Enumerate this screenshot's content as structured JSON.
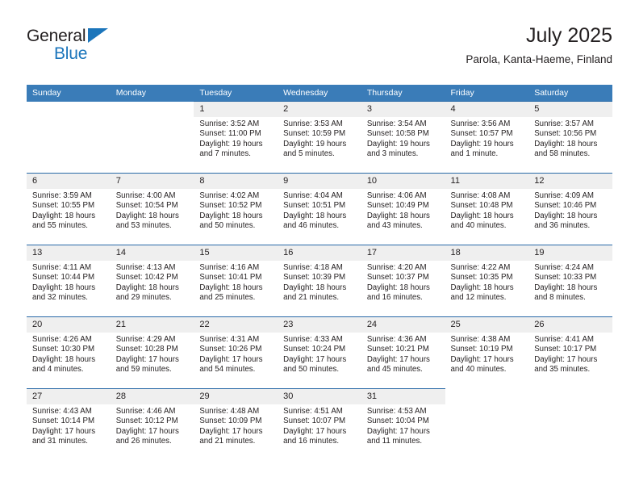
{
  "brand": {
    "line1": "General",
    "line2": "Blue",
    "accent_color": "#1b75bb",
    "triangle_icon": "logo-triangle-icon"
  },
  "header": {
    "title": "July 2025",
    "subtitle": "Parola, Kanta-Haeme, Finland"
  },
  "colors": {
    "header_blue": "#3a7cb8",
    "row_divider_blue": "#2a6aa8",
    "daynum_band": "#efefef",
    "text": "#231f20"
  },
  "weekdays": [
    "Sunday",
    "Monday",
    "Tuesday",
    "Wednesday",
    "Thursday",
    "Friday",
    "Saturday"
  ],
  "weeks": [
    [
      {
        "day": "",
        "sunrise": "",
        "sunset": "",
        "daylight_line1": "",
        "daylight_line2": "",
        "blank": true
      },
      {
        "day": "",
        "sunrise": "",
        "sunset": "",
        "daylight_line1": "",
        "daylight_line2": "",
        "blank": true
      },
      {
        "day": "1",
        "sunrise": "Sunrise: 3:52 AM",
        "sunset": "Sunset: 11:00 PM",
        "daylight_line1": "Daylight: 19 hours",
        "daylight_line2": "and 7 minutes."
      },
      {
        "day": "2",
        "sunrise": "Sunrise: 3:53 AM",
        "sunset": "Sunset: 10:59 PM",
        "daylight_line1": "Daylight: 19 hours",
        "daylight_line2": "and 5 minutes."
      },
      {
        "day": "3",
        "sunrise": "Sunrise: 3:54 AM",
        "sunset": "Sunset: 10:58 PM",
        "daylight_line1": "Daylight: 19 hours",
        "daylight_line2": "and 3 minutes."
      },
      {
        "day": "4",
        "sunrise": "Sunrise: 3:56 AM",
        "sunset": "Sunset: 10:57 PM",
        "daylight_line1": "Daylight: 19 hours",
        "daylight_line2": "and 1 minute."
      },
      {
        "day": "5",
        "sunrise": "Sunrise: 3:57 AM",
        "sunset": "Sunset: 10:56 PM",
        "daylight_line1": "Daylight: 18 hours",
        "daylight_line2": "and 58 minutes."
      }
    ],
    [
      {
        "day": "6",
        "sunrise": "Sunrise: 3:59 AM",
        "sunset": "Sunset: 10:55 PM",
        "daylight_line1": "Daylight: 18 hours",
        "daylight_line2": "and 55 minutes."
      },
      {
        "day": "7",
        "sunrise": "Sunrise: 4:00 AM",
        "sunset": "Sunset: 10:54 PM",
        "daylight_line1": "Daylight: 18 hours",
        "daylight_line2": "and 53 minutes."
      },
      {
        "day": "8",
        "sunrise": "Sunrise: 4:02 AM",
        "sunset": "Sunset: 10:52 PM",
        "daylight_line1": "Daylight: 18 hours",
        "daylight_line2": "and 50 minutes."
      },
      {
        "day": "9",
        "sunrise": "Sunrise: 4:04 AM",
        "sunset": "Sunset: 10:51 PM",
        "daylight_line1": "Daylight: 18 hours",
        "daylight_line2": "and 46 minutes."
      },
      {
        "day": "10",
        "sunrise": "Sunrise: 4:06 AM",
        "sunset": "Sunset: 10:49 PM",
        "daylight_line1": "Daylight: 18 hours",
        "daylight_line2": "and 43 minutes."
      },
      {
        "day": "11",
        "sunrise": "Sunrise: 4:08 AM",
        "sunset": "Sunset: 10:48 PM",
        "daylight_line1": "Daylight: 18 hours",
        "daylight_line2": "and 40 minutes."
      },
      {
        "day": "12",
        "sunrise": "Sunrise: 4:09 AM",
        "sunset": "Sunset: 10:46 PM",
        "daylight_line1": "Daylight: 18 hours",
        "daylight_line2": "and 36 minutes."
      }
    ],
    [
      {
        "day": "13",
        "sunrise": "Sunrise: 4:11 AM",
        "sunset": "Sunset: 10:44 PM",
        "daylight_line1": "Daylight: 18 hours",
        "daylight_line2": "and 32 minutes."
      },
      {
        "day": "14",
        "sunrise": "Sunrise: 4:13 AM",
        "sunset": "Sunset: 10:42 PM",
        "daylight_line1": "Daylight: 18 hours",
        "daylight_line2": "and 29 minutes."
      },
      {
        "day": "15",
        "sunrise": "Sunrise: 4:16 AM",
        "sunset": "Sunset: 10:41 PM",
        "daylight_line1": "Daylight: 18 hours",
        "daylight_line2": "and 25 minutes."
      },
      {
        "day": "16",
        "sunrise": "Sunrise: 4:18 AM",
        "sunset": "Sunset: 10:39 PM",
        "daylight_line1": "Daylight: 18 hours",
        "daylight_line2": "and 21 minutes."
      },
      {
        "day": "17",
        "sunrise": "Sunrise: 4:20 AM",
        "sunset": "Sunset: 10:37 PM",
        "daylight_line1": "Daylight: 18 hours",
        "daylight_line2": "and 16 minutes."
      },
      {
        "day": "18",
        "sunrise": "Sunrise: 4:22 AM",
        "sunset": "Sunset: 10:35 PM",
        "daylight_line1": "Daylight: 18 hours",
        "daylight_line2": "and 12 minutes."
      },
      {
        "day": "19",
        "sunrise": "Sunrise: 4:24 AM",
        "sunset": "Sunset: 10:33 PM",
        "daylight_line1": "Daylight: 18 hours",
        "daylight_line2": "and 8 minutes."
      }
    ],
    [
      {
        "day": "20",
        "sunrise": "Sunrise: 4:26 AM",
        "sunset": "Sunset: 10:30 PM",
        "daylight_line1": "Daylight: 18 hours",
        "daylight_line2": "and 4 minutes."
      },
      {
        "day": "21",
        "sunrise": "Sunrise: 4:29 AM",
        "sunset": "Sunset: 10:28 PM",
        "daylight_line1": "Daylight: 17 hours",
        "daylight_line2": "and 59 minutes."
      },
      {
        "day": "22",
        "sunrise": "Sunrise: 4:31 AM",
        "sunset": "Sunset: 10:26 PM",
        "daylight_line1": "Daylight: 17 hours",
        "daylight_line2": "and 54 minutes."
      },
      {
        "day": "23",
        "sunrise": "Sunrise: 4:33 AM",
        "sunset": "Sunset: 10:24 PM",
        "daylight_line1": "Daylight: 17 hours",
        "daylight_line2": "and 50 minutes."
      },
      {
        "day": "24",
        "sunrise": "Sunrise: 4:36 AM",
        "sunset": "Sunset: 10:21 PM",
        "daylight_line1": "Daylight: 17 hours",
        "daylight_line2": "and 45 minutes."
      },
      {
        "day": "25",
        "sunrise": "Sunrise: 4:38 AM",
        "sunset": "Sunset: 10:19 PM",
        "daylight_line1": "Daylight: 17 hours",
        "daylight_line2": "and 40 minutes."
      },
      {
        "day": "26",
        "sunrise": "Sunrise: 4:41 AM",
        "sunset": "Sunset: 10:17 PM",
        "daylight_line1": "Daylight: 17 hours",
        "daylight_line2": "and 35 minutes."
      }
    ],
    [
      {
        "day": "27",
        "sunrise": "Sunrise: 4:43 AM",
        "sunset": "Sunset: 10:14 PM",
        "daylight_line1": "Daylight: 17 hours",
        "daylight_line2": "and 31 minutes."
      },
      {
        "day": "28",
        "sunrise": "Sunrise: 4:46 AM",
        "sunset": "Sunset: 10:12 PM",
        "daylight_line1": "Daylight: 17 hours",
        "daylight_line2": "and 26 minutes."
      },
      {
        "day": "29",
        "sunrise": "Sunrise: 4:48 AM",
        "sunset": "Sunset: 10:09 PM",
        "daylight_line1": "Daylight: 17 hours",
        "daylight_line2": "and 21 minutes."
      },
      {
        "day": "30",
        "sunrise": "Sunrise: 4:51 AM",
        "sunset": "Sunset: 10:07 PM",
        "daylight_line1": "Daylight: 17 hours",
        "daylight_line2": "and 16 minutes."
      },
      {
        "day": "31",
        "sunrise": "Sunrise: 4:53 AM",
        "sunset": "Sunset: 10:04 PM",
        "daylight_line1": "Daylight: 17 hours",
        "daylight_line2": "and 11 minutes."
      },
      {
        "day": "",
        "sunrise": "",
        "sunset": "",
        "daylight_line1": "",
        "daylight_line2": "",
        "blank": true
      },
      {
        "day": "",
        "sunrise": "",
        "sunset": "",
        "daylight_line1": "",
        "daylight_line2": "",
        "blank": true
      }
    ]
  ]
}
